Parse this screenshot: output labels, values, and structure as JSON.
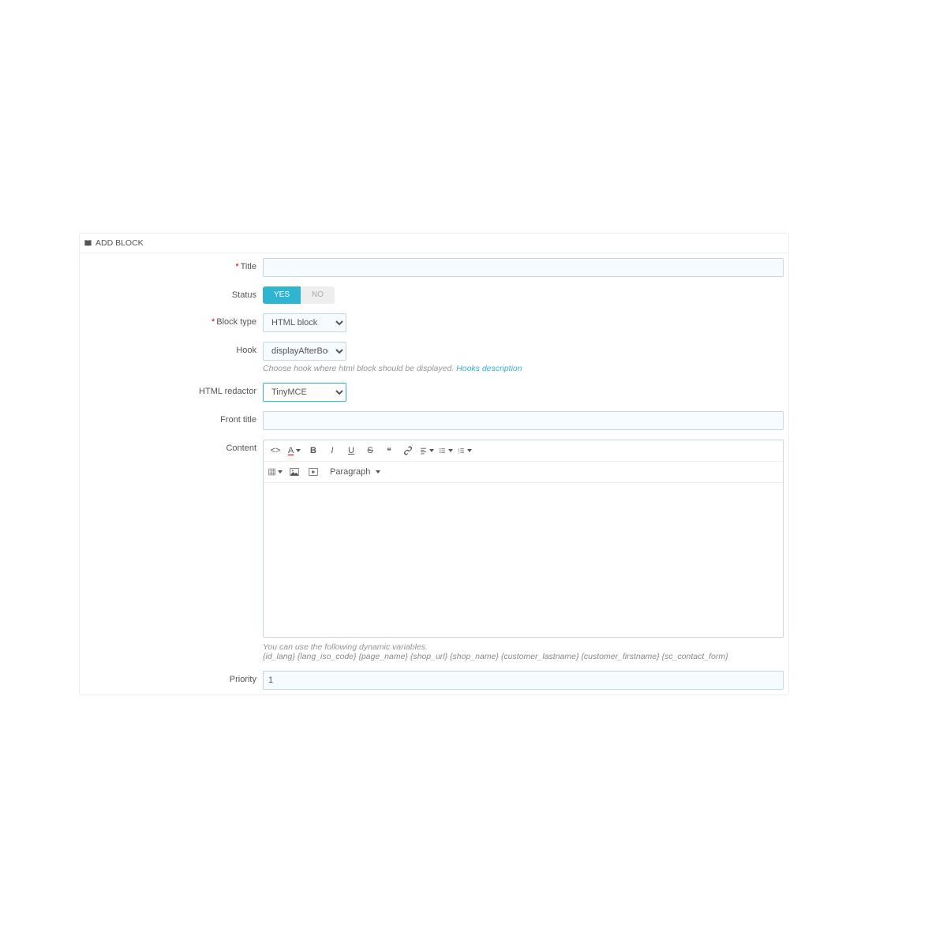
{
  "panel": {
    "title": "ADD BLOCK"
  },
  "labels": {
    "title": "Title",
    "status": "Status",
    "block_type": "Block type",
    "hook": "Hook",
    "html_redactor": "HTML redactor",
    "front_title": "Front title",
    "content": "Content",
    "priority": "Priority"
  },
  "fields": {
    "title": "",
    "status": {
      "yes": "YES",
      "no": "NO",
      "value": "YES"
    },
    "block_type": "HTML block",
    "hook": "displayAfterBodyOpeningTag",
    "html_redactor": "TinyMCE",
    "front_title": "",
    "priority": "1"
  },
  "helpers": {
    "hook_text": "Choose hook where html block should be displayed. ",
    "hook_link": "Hooks description",
    "vars_intro": "You can use the following dynamic variables.",
    "vars_list": "{id_lang} {lang_iso_code} {page_name} {shop_url} {shop_name} {customer_lastname} {customer_firstname} {sc_contact_form}"
  },
  "editor_toolbar": {
    "paragraph": "Paragraph"
  }
}
